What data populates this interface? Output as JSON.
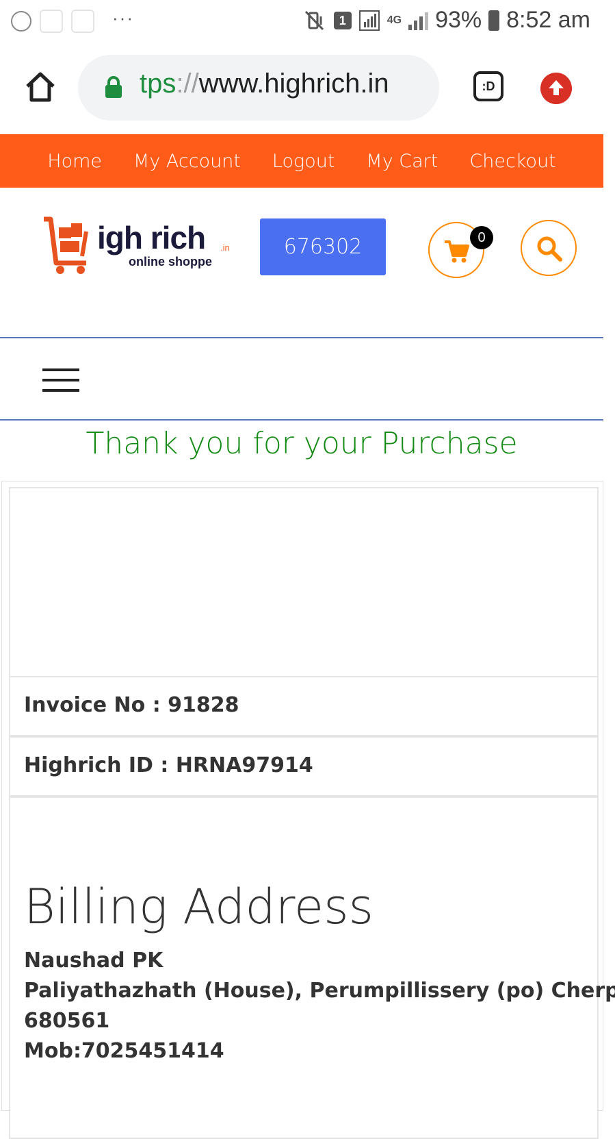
{
  "status_bar": {
    "battery": "93%",
    "time": "8:52 am",
    "network": "4G",
    "sim_slot": "1",
    "more": "···",
    "icons": [
      "nfc-icon",
      "mute-vibrate-icon",
      "sim-icon",
      "signal-icon",
      "battery-icon"
    ]
  },
  "browser": {
    "url_scheme": "tps",
    "url_sep": "://",
    "url_host": "www.highrich.in",
    "reader_label": ":D"
  },
  "nav": {
    "items": [
      "Home",
      "My Account",
      "Logout",
      "My Cart",
      "Checkout"
    ]
  },
  "header": {
    "logo_main": "igh rich",
    "logo_tld": ".in",
    "logo_sub": "online shoppe",
    "pin_code": "676302",
    "cart_count": "0"
  },
  "colors": {
    "nav_bg": "#ff5c1a",
    "pin_button": "#4a6ff0",
    "thanks_text": "#138a13",
    "icon_accent": "#ff8a00"
  },
  "main": {
    "thanks_message": "Thank you for your Purchase",
    "invoice": "Invoice No : 91828",
    "highrich_id": "Highrich ID : HRNA97914",
    "billing_title": "Billing Address",
    "billing_lines": [
      "Naushad PK",
      "Paliyathazhath (House), Perumpillissery (po) Cherpu.",
      "680561",
      "Mob:7025451414"
    ]
  }
}
